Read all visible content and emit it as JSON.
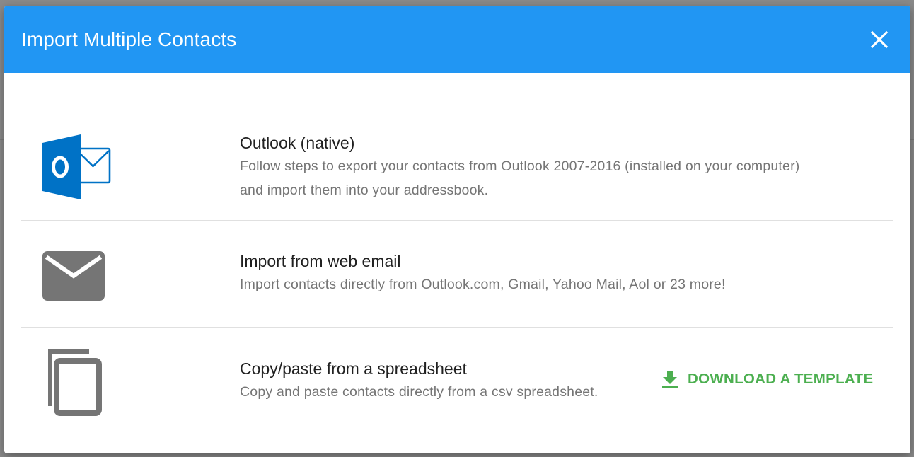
{
  "dialog": {
    "title": "Import Multiple Contacts",
    "close_icon": "close-icon",
    "header_color": "#2196f3"
  },
  "options": [
    {
      "icon": "outlook-icon",
      "title": "Outlook (native)",
      "description_line1": "Follow steps to export your contacts from Outlook 2007-2016 (installed on your computer)",
      "description_line2": "and import them into your addressbook."
    },
    {
      "icon": "envelope-icon",
      "title": "Import from web email",
      "description": "Import contacts directly from Outlook.com, Gmail, Yahoo Mail, Aol or 23 more!"
    },
    {
      "icon": "copy-icon",
      "title": "Copy/paste from a spreadsheet",
      "description": "Copy and paste contacts directly from a csv spreadsheet.",
      "action": {
        "icon": "download-icon",
        "label": "DOWNLOAD A TEMPLATE",
        "color": "#4caf50"
      }
    }
  ]
}
